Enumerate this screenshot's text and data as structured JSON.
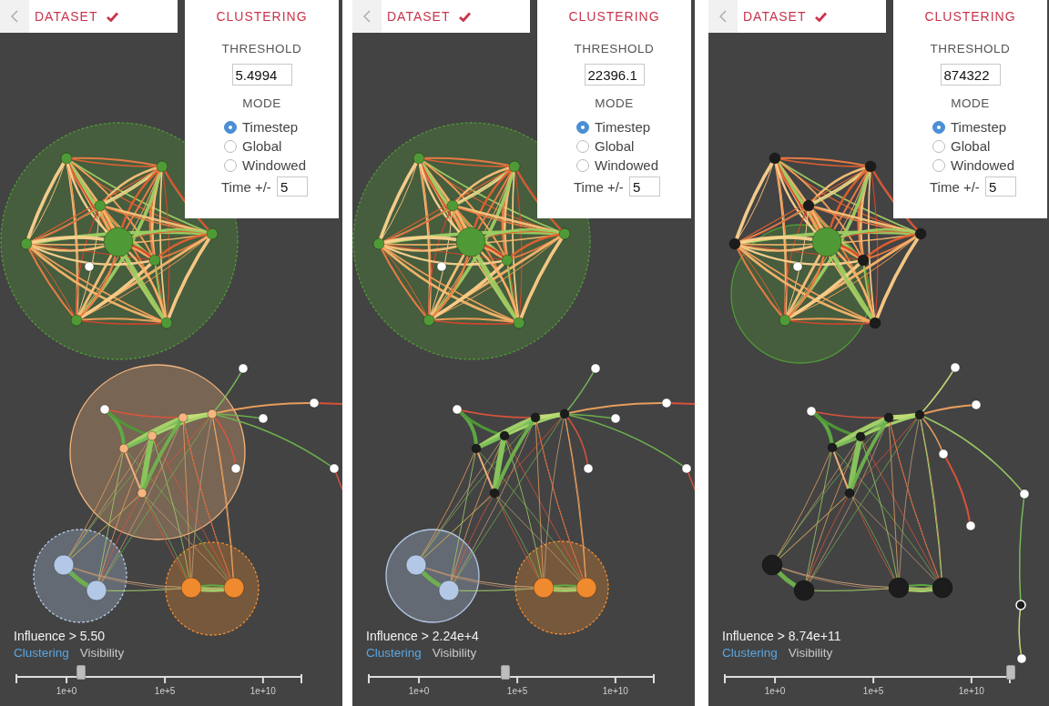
{
  "panels": [
    {
      "breadcrumb": {
        "label": "DATASET",
        "done": true
      },
      "clustering_panel": {
        "title": "CLUSTERING",
        "threshold_label": "THRESHOLD",
        "threshold_value": "5.4994",
        "mode_label": "MODE",
        "modes": [
          {
            "label": "Timestep",
            "selected": true
          },
          {
            "label": "Global",
            "selected": false
          },
          {
            "label": "Windowed",
            "selected": false
          }
        ],
        "time_label": "Time +/-",
        "time_value": "5"
      },
      "graph": {
        "clusters": [
          {
            "color": "#4f9a36"
          },
          {
            "color": "#f4b57f"
          },
          {
            "color": "#b3c7e6"
          },
          {
            "color": "#ef8a2f"
          }
        ]
      },
      "influence": "Influence > 5.50",
      "tabs": [
        {
          "label": "Clustering",
          "selected": true
        },
        {
          "label": "Visibility",
          "selected": false
        }
      ],
      "slider": {
        "level": 0.229,
        "tick_labels": [
          "1e+0",
          "1e+5",
          "1e+10"
        ]
      }
    },
    {
      "breadcrumb": {
        "label": "DATASET",
        "done": true
      },
      "clustering_panel": {
        "title": "CLUSTERING",
        "threshold_label": "THRESHOLD",
        "threshold_value": "22396.1",
        "mode_label": "MODE",
        "modes": [
          {
            "label": "Timestep",
            "selected": true
          },
          {
            "label": "Global",
            "selected": false
          },
          {
            "label": "Windowed",
            "selected": false
          }
        ],
        "time_label": "Time +/-",
        "time_value": "5"
      },
      "graph": {
        "clusters": [
          {
            "color": "#4f9a36"
          },
          {
            "color": "#b3c7e6"
          },
          {
            "color": "#ef8a2f"
          }
        ]
      },
      "influence": "Influence > 2.24e+4",
      "tabs": [
        {
          "label": "Clustering",
          "selected": true
        },
        {
          "label": "Visibility",
          "selected": false
        }
      ],
      "slider": {
        "level": 0.478,
        "tick_labels": [
          "1e+0",
          "1e+5",
          "1e+10"
        ]
      }
    },
    {
      "breadcrumb": {
        "label": "DATASET",
        "done": true
      },
      "clustering_panel": {
        "title": "CLUSTERING",
        "threshold_label": "THRESHOLD",
        "threshold_value": "874322",
        "mode_label": "MODE",
        "modes": [
          {
            "label": "Timestep",
            "selected": true
          },
          {
            "label": "Global",
            "selected": false
          },
          {
            "label": "Windowed",
            "selected": false
          }
        ],
        "time_label": "Time +/-",
        "time_value": "5"
      },
      "graph": {
        "clusters": [
          {
            "color": "#4f9a36"
          }
        ]
      },
      "influence": "Influence > 8.74e+11",
      "tabs": [
        {
          "label": "Clustering",
          "selected": true
        },
        {
          "label": "Visibility",
          "selected": false
        }
      ],
      "slider": {
        "level": 1,
        "tick_labels": [
          "1e+0",
          "1e+5",
          "1e+10"
        ]
      }
    }
  ]
}
